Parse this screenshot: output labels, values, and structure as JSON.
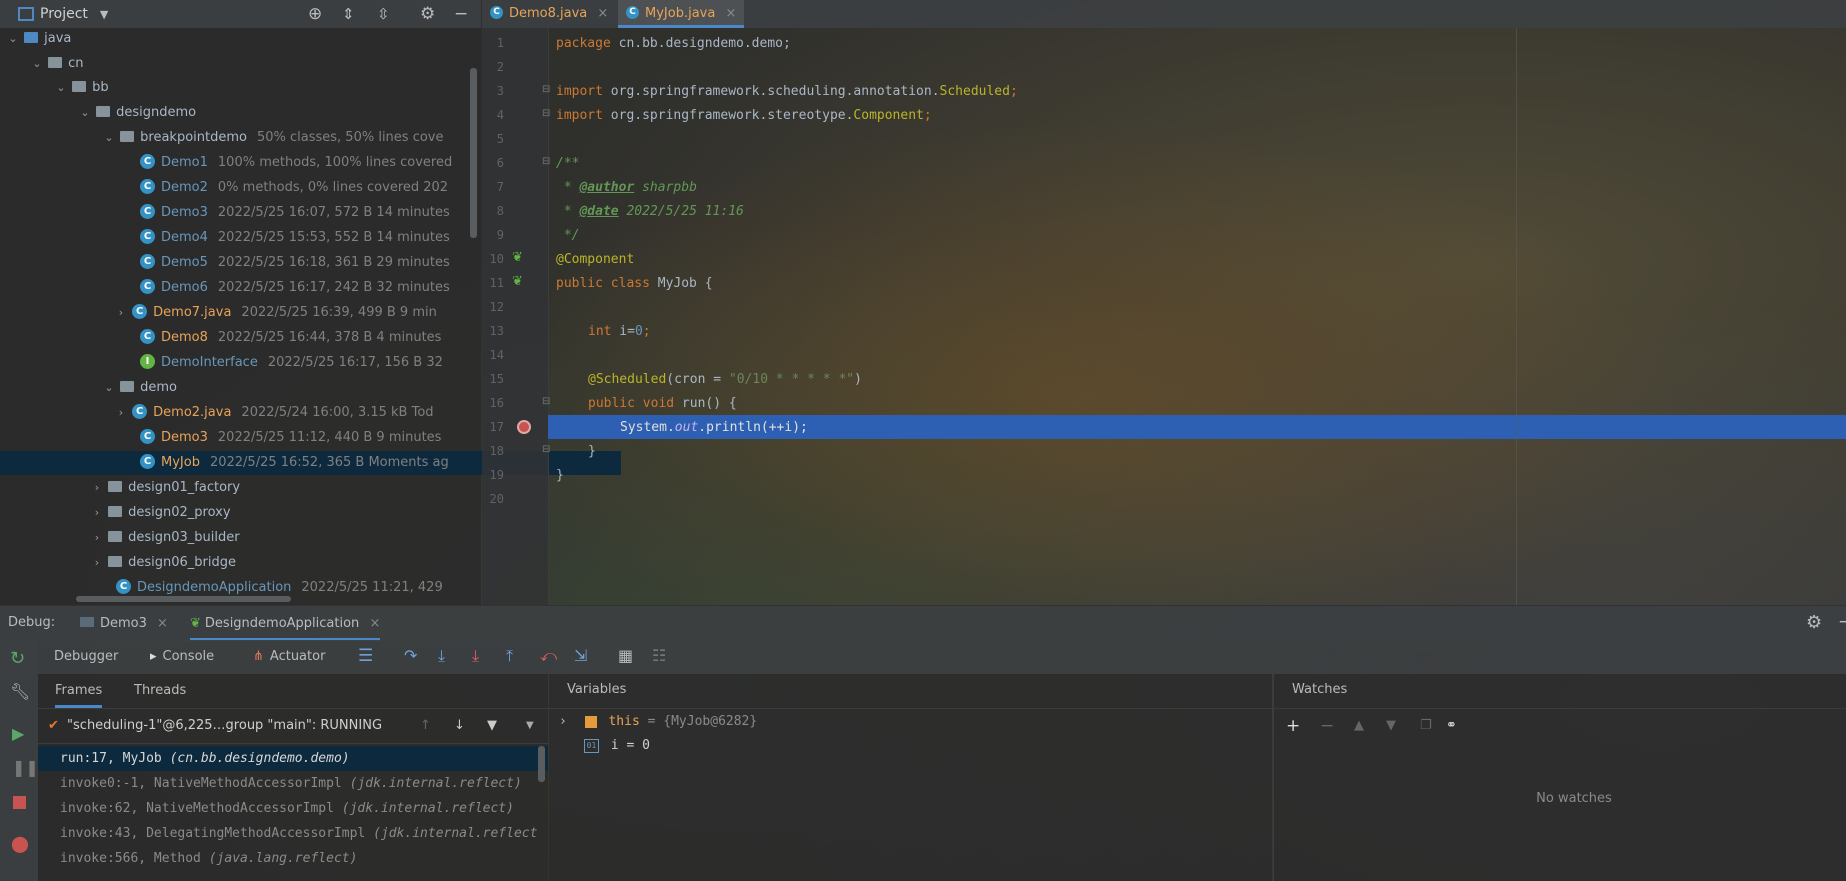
{
  "project": {
    "title": "Project",
    "tree": [
      {
        "name": "java",
        "meta": ""
      },
      {
        "name": "cn",
        "meta": ""
      },
      {
        "name": "bb",
        "meta": ""
      },
      {
        "name": "designdemo",
        "meta": ""
      },
      {
        "name": "breakpointdemo",
        "meta": "50% classes, 50% lines cove"
      },
      {
        "name": "Demo1",
        "meta": "100% methods, 100% lines covered"
      },
      {
        "name": "Demo2",
        "meta": "0% methods, 0% lines covered  202"
      },
      {
        "name": "Demo3",
        "meta": "2022/5/25 16:07, 572 B 14 minutes"
      },
      {
        "name": "Demo4",
        "meta": "2022/5/25 15:53, 552 B 14 minutes"
      },
      {
        "name": "Demo5",
        "meta": "2022/5/25 16:18, 361 B 29 minutes"
      },
      {
        "name": "Demo6",
        "meta": "2022/5/25 16:17, 242 B 32 minutes"
      },
      {
        "name": "Demo7.java",
        "meta": "2022/5/25 16:39, 499 B 9 min"
      },
      {
        "name": "Demo8",
        "meta": "2022/5/25 16:44, 378 B 4 minutes"
      },
      {
        "name": "DemoInterface",
        "meta": "2022/5/25 16:17, 156 B 32"
      },
      {
        "name": "demo",
        "meta": ""
      },
      {
        "name": "Demo2.java",
        "meta": "2022/5/24 16:00, 3.15 kB Tod"
      },
      {
        "name": "Demo3",
        "meta": "2022/5/25 11:12, 440 B 9 minutes"
      },
      {
        "name": "MyJob",
        "meta": "2022/5/25 16:52, 365 B Moments ag"
      },
      {
        "name": "design01_factory",
        "meta": ""
      },
      {
        "name": "design02_proxy",
        "meta": ""
      },
      {
        "name": "design03_builder",
        "meta": ""
      },
      {
        "name": "design06_bridge",
        "meta": ""
      },
      {
        "name": "DesigndemoApplication",
        "meta": "2022/5/25 11:21, 429"
      }
    ]
  },
  "editor": {
    "tabs": [
      {
        "label": "Demo8.java"
      },
      {
        "label": "MyJob.java"
      }
    ],
    "line_numbers": [
      "1",
      "2",
      "3",
      "4",
      "5",
      "6",
      "7",
      "8",
      "9",
      "10",
      "11",
      "12",
      "13",
      "14",
      "15",
      "16",
      "17",
      "18",
      "19",
      "20"
    ],
    "code": {
      "l1_kw": "package",
      "l1_rest": " cn.bb.designdemo.demo;",
      "l3_kw": "import",
      "l3_pkg": " org.springframework.scheduling.annotation.",
      "l3_cls": "Scheduled",
      "l3_end": ";",
      "l4_kw": "import",
      "l4_pkg": " org.springframework.stereotype.",
      "l4_cls": "Component",
      "l4_end": ";",
      "l6": "/**",
      "l7_pre": " * ",
      "l7_tag": "@author",
      "l7_val": " sharpbb",
      "l8_pre": " * ",
      "l8_tag": "@date",
      "l8_val": " 2022/5/25 11:16",
      "l9": " */",
      "l10": "@Component",
      "l11_kw": "public class",
      "l11_rest": " MyJob {",
      "l13_kw": "int",
      "l13_var": " i=",
      "l13_num": "0",
      "l13_end": ";",
      "l15_ann": "@Scheduled",
      "l15_a": "(cron = ",
      "l15_str": "\"0/10 * * * * *\"",
      "l15_b": ")",
      "l16_kw": "public void",
      "l16_rest": " run() {",
      "l17_a": "System.",
      "l17_out": "out",
      "l17_b": ".println(++i);",
      "l18": "}",
      "l19": "}"
    }
  },
  "debug": {
    "label": "Debug:",
    "sessions": [
      {
        "label": "Demo3"
      },
      {
        "label": "DesigndemoApplication"
      }
    ],
    "tabs": {
      "debugger": "Debugger",
      "console": "Console",
      "actuator": "Actuator"
    },
    "frames_tab": "Frames",
    "threads_tab": "Threads",
    "thread": "\"scheduling-1\"@6,225…group \"main\": RUNNING",
    "frames": [
      {
        "method": "run:17, MyJob",
        "pkg": "(cn.bb.designdemo.demo)"
      },
      {
        "method": "invoke0:-1, NativeMethodAccessorImpl",
        "pkg": "(jdk.internal.reflect)"
      },
      {
        "method": "invoke:62, NativeMethodAccessorImpl",
        "pkg": "(jdk.internal.reflect)"
      },
      {
        "method": "invoke:43, DelegatingMethodAccessorImpl",
        "pkg": "(jdk.internal.reflect"
      },
      {
        "method": "invoke:566, Method",
        "pkg": "(java.lang.reflect)"
      }
    ],
    "variables_title": "Variables",
    "variables": [
      {
        "name": "this",
        "value": "= {MyJob@6282}"
      },
      {
        "name": "i",
        "value": "= 0"
      }
    ],
    "watches_title": "Watches",
    "no_watches": "No watches"
  },
  "colors": {
    "accent": "#4a88c7",
    "exec_line": "#2d5fb3",
    "selection": "#0d293e"
  }
}
